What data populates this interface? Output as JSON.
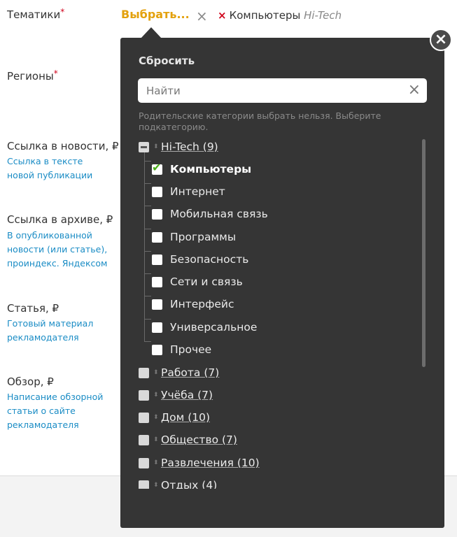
{
  "form": {
    "topics_label": "Тематики",
    "required_mark": "*",
    "regions_label": "Регионы",
    "fields": [
      {
        "label": "Ссылка в новости, ₽",
        "hint": "Ссылка в тексте новой публикации"
      },
      {
        "label": "Ссылка в архиве, ₽",
        "hint": "В опубликованной новости (или статье), проиндекс. Яндексом"
      },
      {
        "label": "Статья, ₽",
        "hint": "Готовый материал рекламодателя"
      },
      {
        "label": "Обзор, ₽",
        "hint": "Написание обзорной статьи о сайте рекламодателя"
      }
    ]
  },
  "selector": {
    "select_label": "Выбрать...",
    "clear_icon": "×",
    "chip_remove_icon": "×",
    "chip_label": "Компьютеры",
    "chip_parent": "Hi-Tech"
  },
  "dropdown": {
    "close_icon": "×",
    "reset_label": "Сбросить",
    "search_placeholder": "Найти",
    "search_value": "",
    "search_clear_icon": "×",
    "note": "Родительские категории выбрать нельзя. Выберите подкатегорию.",
    "parent": "Hi-Tech (9)",
    "children": [
      "Компьютеры",
      "Интернет",
      "Мобильная связь",
      "Программы",
      "Безопасность",
      "Сети и связь",
      "Интерфейс",
      "Универсальное",
      "Прочее"
    ],
    "checked_child": "Компьютеры",
    "other_categories": [
      "Работа (7)",
      "Учёба (7)",
      "Дом (10)",
      "Общество (7)",
      "Развлечения (10)",
      "Отдых (4)"
    ],
    "sort_icon": "⬍"
  },
  "colors": {
    "accent": "#e3a10d",
    "link": "#1a8cc5",
    "panel": "#353535",
    "required": "#d0021b",
    "check": "#4caf1a"
  }
}
